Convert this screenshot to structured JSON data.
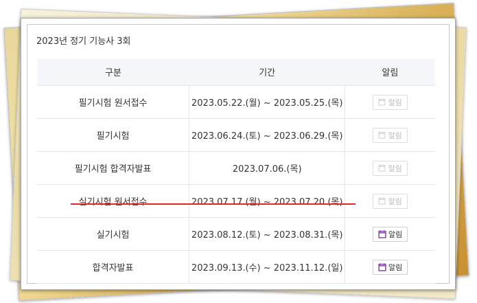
{
  "section": {
    "title": "2023년 정기 기능사 3회"
  },
  "table": {
    "headers": {
      "category": "구분",
      "period": "기간",
      "alarm": "알림"
    },
    "rows": [
      {
        "category": "필기시험 원서접수",
        "period": "2023.05.22.(월) ~ 2023.05.25.(목)",
        "alarm": "알림",
        "active": false
      },
      {
        "category": "필기시험",
        "period": "2023.06.24.(토) ~ 2023.06.29.(목)",
        "alarm": "알림",
        "active": false
      },
      {
        "category": "필기시험 합격자발표",
        "period": "2023.07.06.(목)",
        "alarm": "알림",
        "active": false
      },
      {
        "category": "실기시험 원서접수",
        "period": "2023.07.17.(월) ~ 2023.07.20.(목)",
        "alarm": "알림",
        "active": false
      },
      {
        "category": "실기시험",
        "period": "2023.08.12.(토) ~ 2023.08.31.(목)",
        "alarm": "알림",
        "active": true
      },
      {
        "category": "합격자발표",
        "period": "2023.09.13.(수) ~ 2023.11.12.(일)",
        "alarm": "알림",
        "active": true
      }
    ]
  },
  "icons": {
    "alarm": "calendar-icon"
  },
  "colors": {
    "active_icon": "#7b3fa0",
    "inactive_icon": "#cccccc",
    "highlight_line": "#e2242b",
    "header_bg": "#f4f6f9"
  }
}
